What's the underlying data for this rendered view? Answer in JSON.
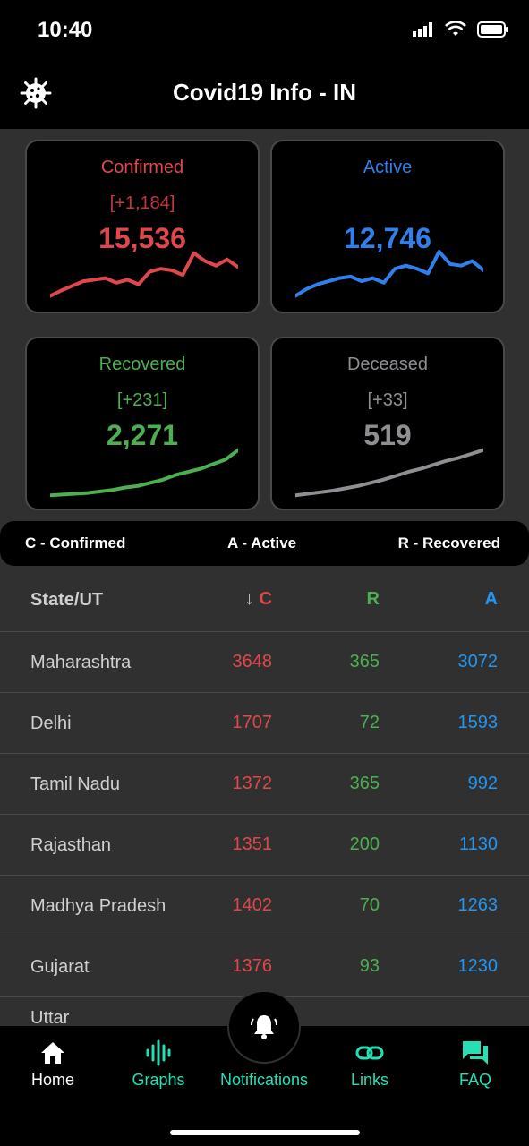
{
  "status_bar": {
    "time": "10:40"
  },
  "header": {
    "title": "Covid19 Info - IN"
  },
  "cards": [
    {
      "label": "Confirmed",
      "delta": "[+1,184]",
      "value": "15,536",
      "color": "#e0474c",
      "dim_color": "#c2363c",
      "sparkline": [
        5,
        12,
        18,
        24,
        26,
        28,
        22,
        26,
        20,
        36,
        40,
        38,
        32,
        60,
        50,
        44,
        52,
        42
      ]
    },
    {
      "label": "Active",
      "delta": "",
      "value": "12,746",
      "color": "#2f80ed",
      "dim_color": "#2f80ed",
      "sparkline": [
        5,
        14,
        20,
        24,
        28,
        30,
        24,
        28,
        22,
        40,
        44,
        40,
        34,
        62,
        46,
        44,
        50,
        38
      ]
    },
    {
      "label": "Recovered",
      "delta": "[+231]",
      "value": "2,271",
      "color": "#4caf50",
      "dim_color": "#4caf50",
      "sparkline": [
        2,
        3,
        4,
        5,
        7,
        9,
        12,
        14,
        18,
        22,
        28,
        32,
        36,
        42,
        48,
        60
      ]
    },
    {
      "label": "Deceased",
      "delta": "[+33]",
      "value": "519",
      "color": "#8e8e93",
      "dim_color": "#8e8e93",
      "sparkline": [
        2,
        4,
        6,
        8,
        11,
        14,
        18,
        22,
        27,
        32,
        36,
        41,
        46,
        50,
        55,
        60
      ]
    }
  ],
  "legend": {
    "c": "C - Confirmed",
    "a": "A - Active",
    "r": "R - Recovered"
  },
  "table": {
    "headers": {
      "state": "State/UT",
      "c": "C",
      "r": "R",
      "a": "A",
      "sort_icon": "↓"
    },
    "rows": [
      {
        "state": "Maharashtra",
        "c": "3648",
        "r": "365",
        "a": "3072"
      },
      {
        "state": "Delhi",
        "c": "1707",
        "r": "72",
        "a": "1593"
      },
      {
        "state": "Tamil Nadu",
        "c": "1372",
        "r": "365",
        "a": "992"
      },
      {
        "state": "Rajasthan",
        "c": "1351",
        "r": "200",
        "a": "1130"
      },
      {
        "state": "Madhya Pradesh",
        "c": "1402",
        "r": "70",
        "a": "1263"
      },
      {
        "state": "Gujarat",
        "c": "1376",
        "r": "93",
        "a": "1230"
      }
    ],
    "partial_row_state": "Uttar"
  },
  "nav": {
    "items": [
      {
        "label": "Home",
        "icon": "home-icon"
      },
      {
        "label": "Graphs",
        "icon": "graphs-icon"
      },
      {
        "label": "Notifications",
        "icon": "bell-icon"
      },
      {
        "label": "Links",
        "icon": "link-icon"
      },
      {
        "label": "FAQ",
        "icon": "faq-icon"
      }
    ],
    "accent": "#26e0b5"
  }
}
